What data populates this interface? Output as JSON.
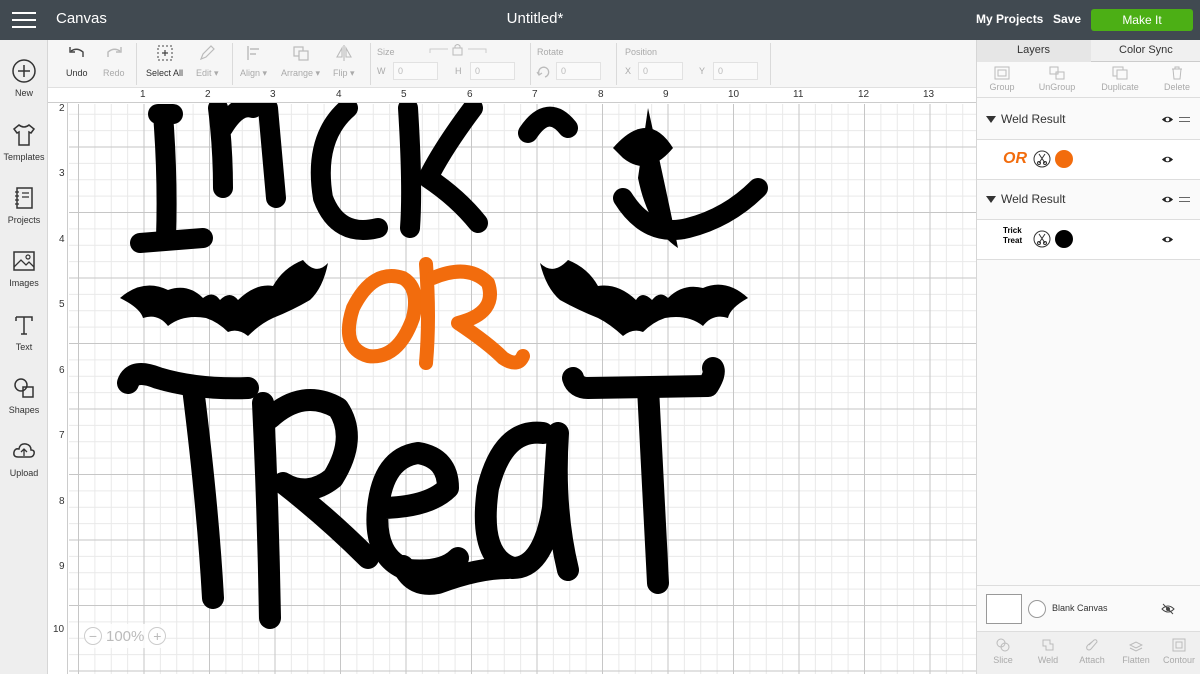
{
  "topbar": {
    "app_title": "Canvas",
    "doc_title": "Untitled*",
    "my_projects": "My Projects",
    "save": "Save",
    "make_it": "Make It"
  },
  "sidebar": {
    "items": [
      {
        "label": "New",
        "icon": "plus-circle-icon"
      },
      {
        "label": "Templates",
        "icon": "tshirt-icon"
      },
      {
        "label": "Projects",
        "icon": "notebook-icon"
      },
      {
        "label": "Images",
        "icon": "image-icon"
      },
      {
        "label": "Text",
        "icon": "text-t-icon"
      },
      {
        "label": "Shapes",
        "icon": "shapes-icon"
      },
      {
        "label": "Upload",
        "icon": "cloud-upload-icon"
      }
    ]
  },
  "toolbar": {
    "undo": "Undo",
    "redo": "Redo",
    "select_all": "Select All",
    "edit": "Edit",
    "align": "Align",
    "arrange": "Arrange",
    "flip": "Flip",
    "size_label": "Size",
    "w_label": "W",
    "h_label": "H",
    "w_value": "0",
    "h_value": "0",
    "rotate_label": "Rotate",
    "rotate_value": "0",
    "position_label": "Position",
    "x_label": "X",
    "y_label": "Y",
    "x_value": "0",
    "y_value": "0"
  },
  "canvas": {
    "ruler_top": [
      "1",
      "2",
      "3",
      "4",
      "5",
      "6",
      "7",
      "8",
      "9",
      "10",
      "11",
      "12",
      "13"
    ],
    "ruler_left": [
      "2",
      "3",
      "4",
      "5",
      "6",
      "7",
      "8",
      "9",
      "10"
    ],
    "zoom_level": "100%",
    "artwork": {
      "word1": "Trick",
      "word2": "OR",
      "word3": "Treat",
      "color_black": "#000000",
      "color_orange": "#f26c0d"
    }
  },
  "panel": {
    "tabs": [
      "Layers",
      "Color Sync"
    ],
    "actions": [
      "Group",
      "UnGroup",
      "Duplicate",
      "Delete"
    ],
    "groups": [
      {
        "label": "Weld Result",
        "thumb_text": "OR",
        "color": "#f26c0d"
      },
      {
        "label": "Weld Result",
        "thumb_text": "Trick Treat",
        "color": "#000000"
      }
    ],
    "blank_canvas": "Blank Canvas",
    "bottom_actions": [
      "Slice",
      "Weld",
      "Attach",
      "Flatten",
      "Contour"
    ]
  }
}
